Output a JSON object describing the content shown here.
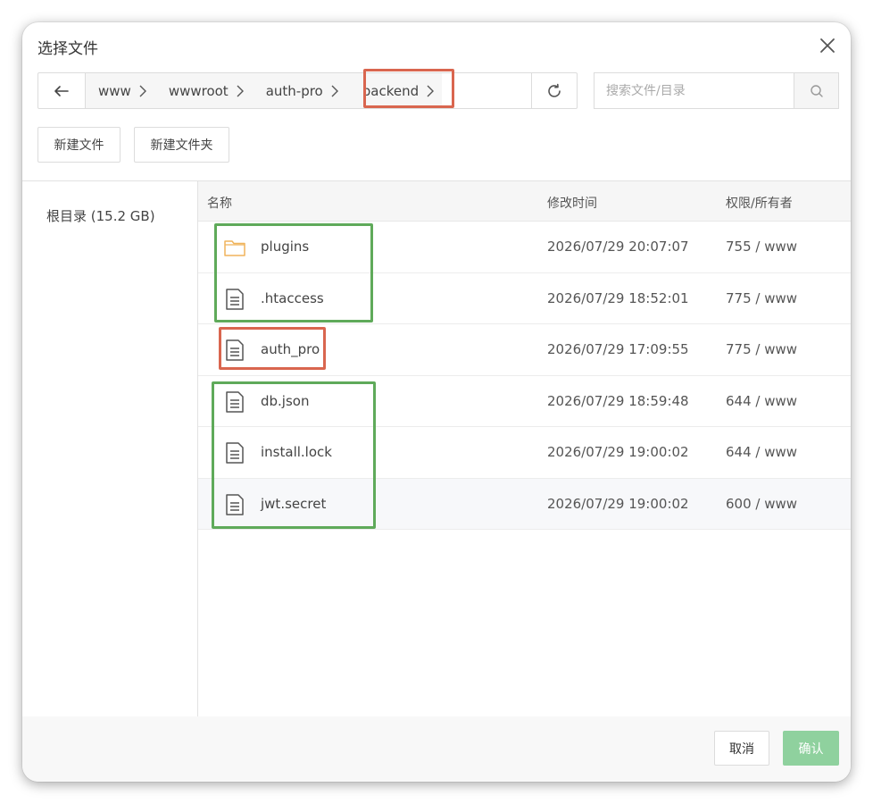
{
  "dialog": {
    "title": "选择文件",
    "close_icon": "close-icon"
  },
  "pathbar": {
    "back_icon": "arrow-left-icon",
    "crumbs": [
      "www",
      "wwwroot",
      "auth-pro",
      "backend"
    ],
    "refresh_icon": "refresh-icon"
  },
  "search": {
    "placeholder": "搜索文件/目录",
    "value": "",
    "icon": "search-icon"
  },
  "actions": {
    "new_file": "新建文件",
    "new_folder": "新建文件夹"
  },
  "sidebar": {
    "root_label": "根目录 (15.2 GB)"
  },
  "table": {
    "headers": {
      "name": "名称",
      "mtime": "修改时间",
      "perm": "权限/所有者"
    },
    "rows": [
      {
        "icon": "folder-icon",
        "name": "plugins",
        "mtime": "2026/07/29 20:07:07",
        "perm": "755 / www"
      },
      {
        "icon": "file-icon",
        "name": ".htaccess",
        "mtime": "2026/07/29 18:52:01",
        "perm": "775 / www"
      },
      {
        "icon": "file-icon",
        "name": "auth_pro",
        "mtime": "2026/07/29 17:09:55",
        "perm": "775 / www"
      },
      {
        "icon": "file-icon",
        "name": "db.json",
        "mtime": "2026/07/29 18:59:48",
        "perm": "644 / www"
      },
      {
        "icon": "file-icon",
        "name": "install.lock",
        "mtime": "2026/07/29 19:00:02",
        "perm": "644 / www"
      },
      {
        "icon": "file-icon",
        "name": "jwt.secret",
        "mtime": "2026/07/29 19:00:02",
        "perm": "600 / www"
      }
    ]
  },
  "footer": {
    "cancel": "取消",
    "confirm": "确认"
  },
  "colors": {
    "annotation_red": "#d9664f",
    "annotation_green": "#5faa5a",
    "folder": "#f0b45c",
    "confirm_bg": "#8fd19e"
  }
}
